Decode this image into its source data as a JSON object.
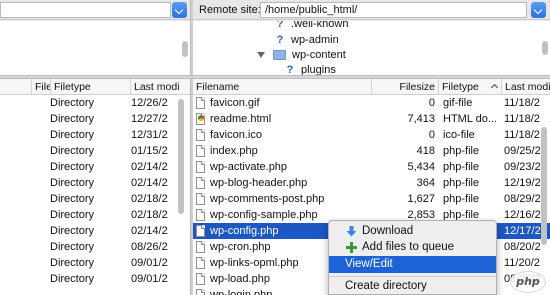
{
  "local": {
    "path_value": "",
    "columns": [
      "File",
      "Filetype",
      "Last modi"
    ],
    "rows": [
      {
        "filetype": "",
        "modified": ""
      },
      {
        "filetype": "Directory",
        "modified": "12/26/2"
      },
      {
        "filetype": "Directory",
        "modified": "12/27/2"
      },
      {
        "filetype": "Directory",
        "modified": "12/31/2"
      },
      {
        "filetype": "Directory",
        "modified": "01/15/2"
      },
      {
        "filetype": "Directory",
        "modified": "02/14/2"
      },
      {
        "filetype": "Directory",
        "modified": "02/14/2"
      },
      {
        "filetype": "Directory",
        "modified": "02/18/2"
      },
      {
        "filetype": "Directory",
        "modified": "02/18/2"
      },
      {
        "filetype": "Directory",
        "modified": "02/14/2"
      },
      {
        "filetype": "Directory",
        "modified": "08/26/2"
      },
      {
        "filetype": "Directory",
        "modified": "09/01/2"
      },
      {
        "filetype": "Directory",
        "modified": "09/01/2"
      }
    ]
  },
  "remote": {
    "label": "Remote site:",
    "path_value": "/home/public_html/",
    "tree": [
      ".well-known",
      "wp-admin",
      "wp-content",
      "plugins"
    ],
    "columns": [
      "Filename",
      "Filesize",
      "Filetype",
      "Last modi"
    ],
    "rows": [
      {
        "name": "",
        "size": "",
        "type": "",
        "modified": ""
      },
      {
        "name": "favicon.gif",
        "size": "0",
        "type": "gif-file",
        "modified": "11/18/2"
      },
      {
        "name": "readme.html",
        "size": "7,413",
        "type": "HTML do...",
        "modified": "11/18/2"
      },
      {
        "name": "favicon.ico",
        "size": "0",
        "type": "ico-file",
        "modified": "11/18/2"
      },
      {
        "name": "index.php",
        "size": "418",
        "type": "php-file",
        "modified": "09/25/2"
      },
      {
        "name": "wp-activate.php",
        "size": "5,434",
        "type": "php-file",
        "modified": "09/23/2"
      },
      {
        "name": "wp-blog-header.php",
        "size": "364",
        "type": "php-file",
        "modified": "12/19/2"
      },
      {
        "name": "wp-comments-post.php",
        "size": "1,627",
        "type": "php-file",
        "modified": "08/29/2"
      },
      {
        "name": "wp-config-sample.php",
        "size": "2,853",
        "type": "php-file",
        "modified": "12/16/2"
      },
      {
        "name": "wp-config.php",
        "size": "",
        "type": "",
        "modified": "12/17/2"
      },
      {
        "name": "wp-cron.php",
        "size": "",
        "type": "",
        "modified": "08/20/2"
      },
      {
        "name": "wp-links-opml.php",
        "size": "",
        "type": "",
        "modified": "11/20/2"
      },
      {
        "name": "wp-load.php",
        "size": "",
        "type": "",
        "modified": "08/22/2"
      },
      {
        "name": "wp-login.php",
        "size": "",
        "type": "",
        "modified": ""
      }
    ],
    "selected_row": 9
  },
  "context_menu": {
    "items": [
      "Download",
      "Add files to queue",
      "View/Edit",
      "Create directory"
    ],
    "highlighted": 2
  },
  "watermark": "php",
  "colors": {
    "selection": "#1c57c4",
    "menu_highlight": "#1d63d6",
    "dropdown_button": "#2c72e3"
  }
}
